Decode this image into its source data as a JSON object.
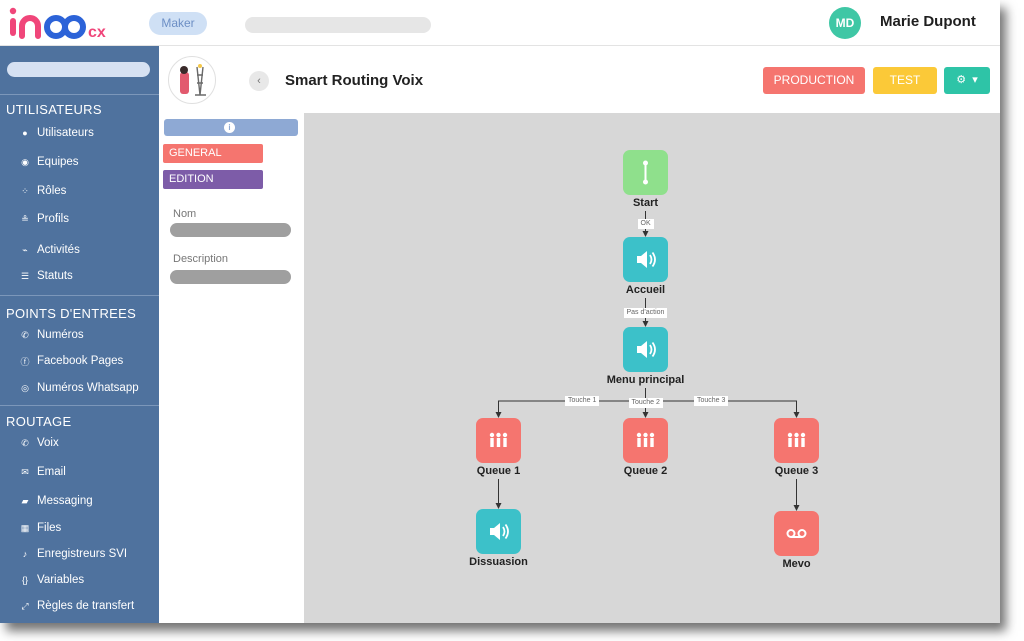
{
  "header": {
    "logo_text": "ino",
    "logo_suffix": "cx",
    "maker_label": "Maker",
    "avatar_initials": "MD",
    "user_name": "Marie Dupont"
  },
  "sidebar": {
    "sections": [
      {
        "title": "UTILISATEURS",
        "items": [
          {
            "label": "Utilisateurs",
            "icon": "user-icon"
          },
          {
            "label": "Equipes",
            "icon": "team-icon"
          },
          {
            "label": "Rôles",
            "icon": "roles-icon"
          },
          {
            "label": "Profils",
            "icon": "profiles-icon"
          },
          {
            "label": "Activités",
            "icon": "activity-icon"
          },
          {
            "label": "Statuts",
            "icon": "list-icon"
          }
        ]
      },
      {
        "title": "POINTS D'ENTREES",
        "items": [
          {
            "label": "Numéros",
            "icon": "phone-icon"
          },
          {
            "label": "Facebook Pages",
            "icon": "facebook-icon"
          },
          {
            "label": "Numéros Whatsapp",
            "icon": "whatsapp-icon"
          }
        ]
      },
      {
        "title": "ROUTAGE",
        "items": [
          {
            "label": "Voix",
            "icon": "phone-icon"
          },
          {
            "label": "Email",
            "icon": "email-icon"
          },
          {
            "label": "Messaging",
            "icon": "chat-icon"
          },
          {
            "label": "Files",
            "icon": "queue-icon"
          },
          {
            "label": "Enregistreurs SVI",
            "icon": "microphone-icon"
          },
          {
            "label": "Variables",
            "icon": "braces-icon"
          },
          {
            "label": "Règles de transfert",
            "icon": "transfer-icon"
          }
        ]
      }
    ]
  },
  "flow": {
    "title": "Smart Routing Voix",
    "buttons": {
      "production": "PRODUCTION",
      "test": "TEST"
    },
    "tabs": {
      "general": "GENERAL",
      "edition": "EDITION"
    },
    "fields": {
      "name_label": "Nom",
      "description_label": "Description"
    }
  },
  "diagram": {
    "nodes": [
      {
        "id": "start",
        "label": "Start",
        "icon": "start-icon",
        "color": "#8fe08c"
      },
      {
        "id": "accueil",
        "label": "Accueil",
        "icon": "speaker-icon",
        "color": "#3cc1c9"
      },
      {
        "id": "menu",
        "label": "Menu principal",
        "icon": "speaker-icon",
        "color": "#3cc1c9"
      },
      {
        "id": "q1",
        "label": "Queue 1",
        "icon": "queue-icon",
        "color": "#f5756f"
      },
      {
        "id": "q2",
        "label": "Queue 2",
        "icon": "queue-icon",
        "color": "#f5756f"
      },
      {
        "id": "q3",
        "label": "Queue 3",
        "icon": "queue-icon",
        "color": "#f5756f"
      },
      {
        "id": "dissuasion",
        "label": "Dissuasion",
        "icon": "speaker-icon",
        "color": "#3cc1c9"
      },
      {
        "id": "mevo",
        "label": "Mevo",
        "icon": "voicemail-icon",
        "color": "#f5756f"
      }
    ],
    "edges": [
      {
        "from": "start",
        "to": "accueil",
        "label": "OK"
      },
      {
        "from": "accueil",
        "to": "menu",
        "label": "Pas d'action"
      },
      {
        "from": "menu",
        "to": "q1",
        "label": "Touche 1"
      },
      {
        "from": "menu",
        "to": "q2",
        "label": "Touche 2"
      },
      {
        "from": "menu",
        "to": "q3",
        "label": "Touche 3"
      },
      {
        "from": "q1",
        "to": "dissuasion",
        "label": ""
      },
      {
        "from": "q3",
        "to": "mevo",
        "label": ""
      }
    ]
  },
  "colors": {
    "sidebar": "#4f729e",
    "production": "#f5756f",
    "test": "#fbc938",
    "settings": "#2ec4a7",
    "general_tab": "#f5756f",
    "edition_tab": "#7d5ca8",
    "canvas": "#d7d7d7"
  }
}
